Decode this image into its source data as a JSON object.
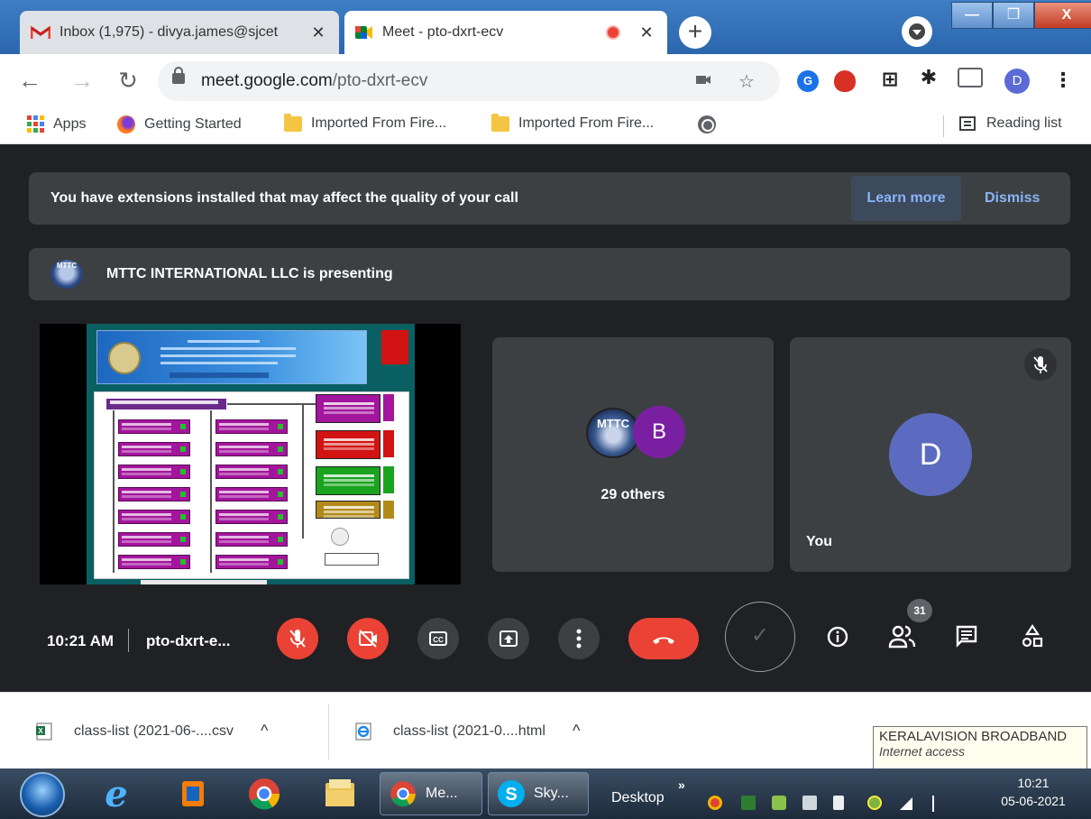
{
  "browser": {
    "tabs": [
      {
        "title": "Inbox (1,975) - divya.james@sjcet",
        "close": "✕"
      },
      {
        "title": "Meet - pto-dxrt-ecv",
        "close": "✕"
      }
    ],
    "new_tab": "+",
    "url_host": "meet.google.com",
    "url_path": "/pto-dxrt-ecv",
    "profile_initial": "D",
    "extension_g": "G",
    "window_buttons": {
      "minimize": "—",
      "maximize": "❐",
      "close": "X"
    }
  },
  "bookmarks": [
    {
      "label": "Apps",
      "icon": "apps-grid-icon"
    },
    {
      "label": "Getting Started",
      "icon": "firefox-icon"
    },
    {
      "label": "Imported From Fire...",
      "icon": "folder-icon"
    },
    {
      "label": "Imported From Fire...",
      "icon": "folder-icon"
    }
  ],
  "reading_list": "Reading list",
  "meet": {
    "banner_text": "You have extensions installed that may affect the quality of your call",
    "learn_more": "Learn more",
    "dismiss": "Dismiss",
    "presenter_logo_text": "MTTC",
    "presenting_text": "MTTC INTERNATIONAL LLC is presenting",
    "group_logo_text": "MTTC",
    "group_avatar_initial": "B",
    "others_label": "29 others",
    "self_initial": "D",
    "self_label": "You",
    "time": "10:21 AM",
    "meeting_code": "pto-dxrt-e...",
    "participants_count": "31",
    "activity_check": "✓"
  },
  "downloads": [
    {
      "name": "class-list (2021-06-....csv",
      "icon": "excel-file-icon",
      "chevron": "^"
    },
    {
      "name": "class-list (2021-0....html",
      "icon": "ie-file-icon",
      "chevron": "^"
    }
  ],
  "tooltip": {
    "title": "KERALAVISION BROADBAND",
    "subtitle": "Internet access"
  },
  "taskbar": {
    "buttons": [
      {
        "label": "Me..."
      },
      {
        "label": "Sky..."
      }
    ],
    "desktop_label": "Desktop",
    "chevron": "»",
    "clock_time": "10:21",
    "clock_date": "05-06-2021"
  },
  "colors": {
    "meet_bg": "#202124",
    "tile_bg": "#3c4043",
    "red_button": "#ea4335",
    "link_blue": "#8ab4f8",
    "avatar_b": "#7b1fa2",
    "avatar_self": "#5c6bc0"
  }
}
